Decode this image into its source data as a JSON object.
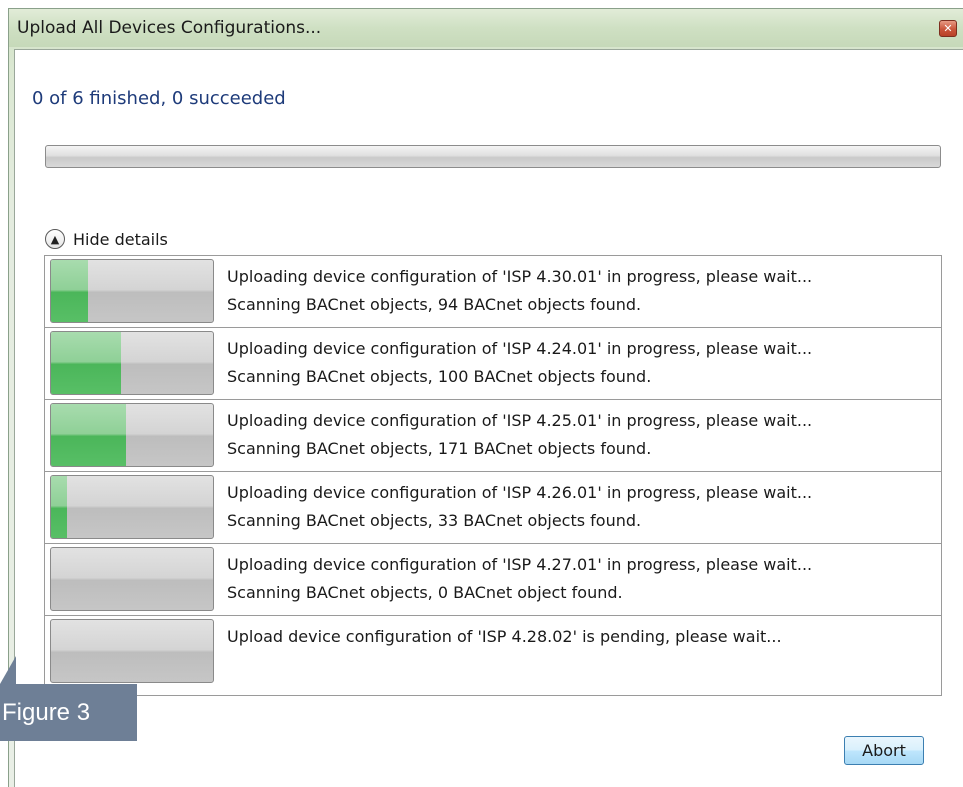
{
  "window": {
    "title": "Upload All Devices Configurations...",
    "close_icon": "close-icon"
  },
  "summary_text": "0 of 6 finished, 0 succeeded",
  "overall_progress": 0,
  "details_toggle": {
    "label": "Hide details",
    "icon": "chevron-up-icon"
  },
  "devices": [
    {
      "line1": "Uploading device configuration of 'ISP 4.30.01' in progress, please wait...",
      "line2": "Scanning BACnet objects, 94 BACnet objects found.",
      "progress": 0.23
    },
    {
      "line1": "Uploading device configuration of 'ISP 4.24.01' in progress, please wait...",
      "line2": "Scanning BACnet objects, 100 BACnet objects found.",
      "progress": 0.43
    },
    {
      "line1": "Uploading device configuration of 'ISP 4.25.01' in progress, please wait...",
      "line2": "Scanning BACnet objects, 171 BACnet objects found.",
      "progress": 0.46
    },
    {
      "line1": "Uploading device configuration of 'ISP 4.26.01' in progress, please wait...",
      "line2": "Scanning BACnet objects, 33 BACnet objects found.",
      "progress": 0.1
    },
    {
      "line1": "Uploading device configuration of 'ISP 4.27.01' in progress, please wait...",
      "line2": "Scanning BACnet objects, 0 BACnet object found.",
      "progress": 0
    },
    {
      "line1": "Upload device configuration of 'ISP 4.28.02' is pending, please wait...",
      "line2": "",
      "progress": 0
    }
  ],
  "abort_label": "Abort",
  "figure_label": "Figure 3"
}
